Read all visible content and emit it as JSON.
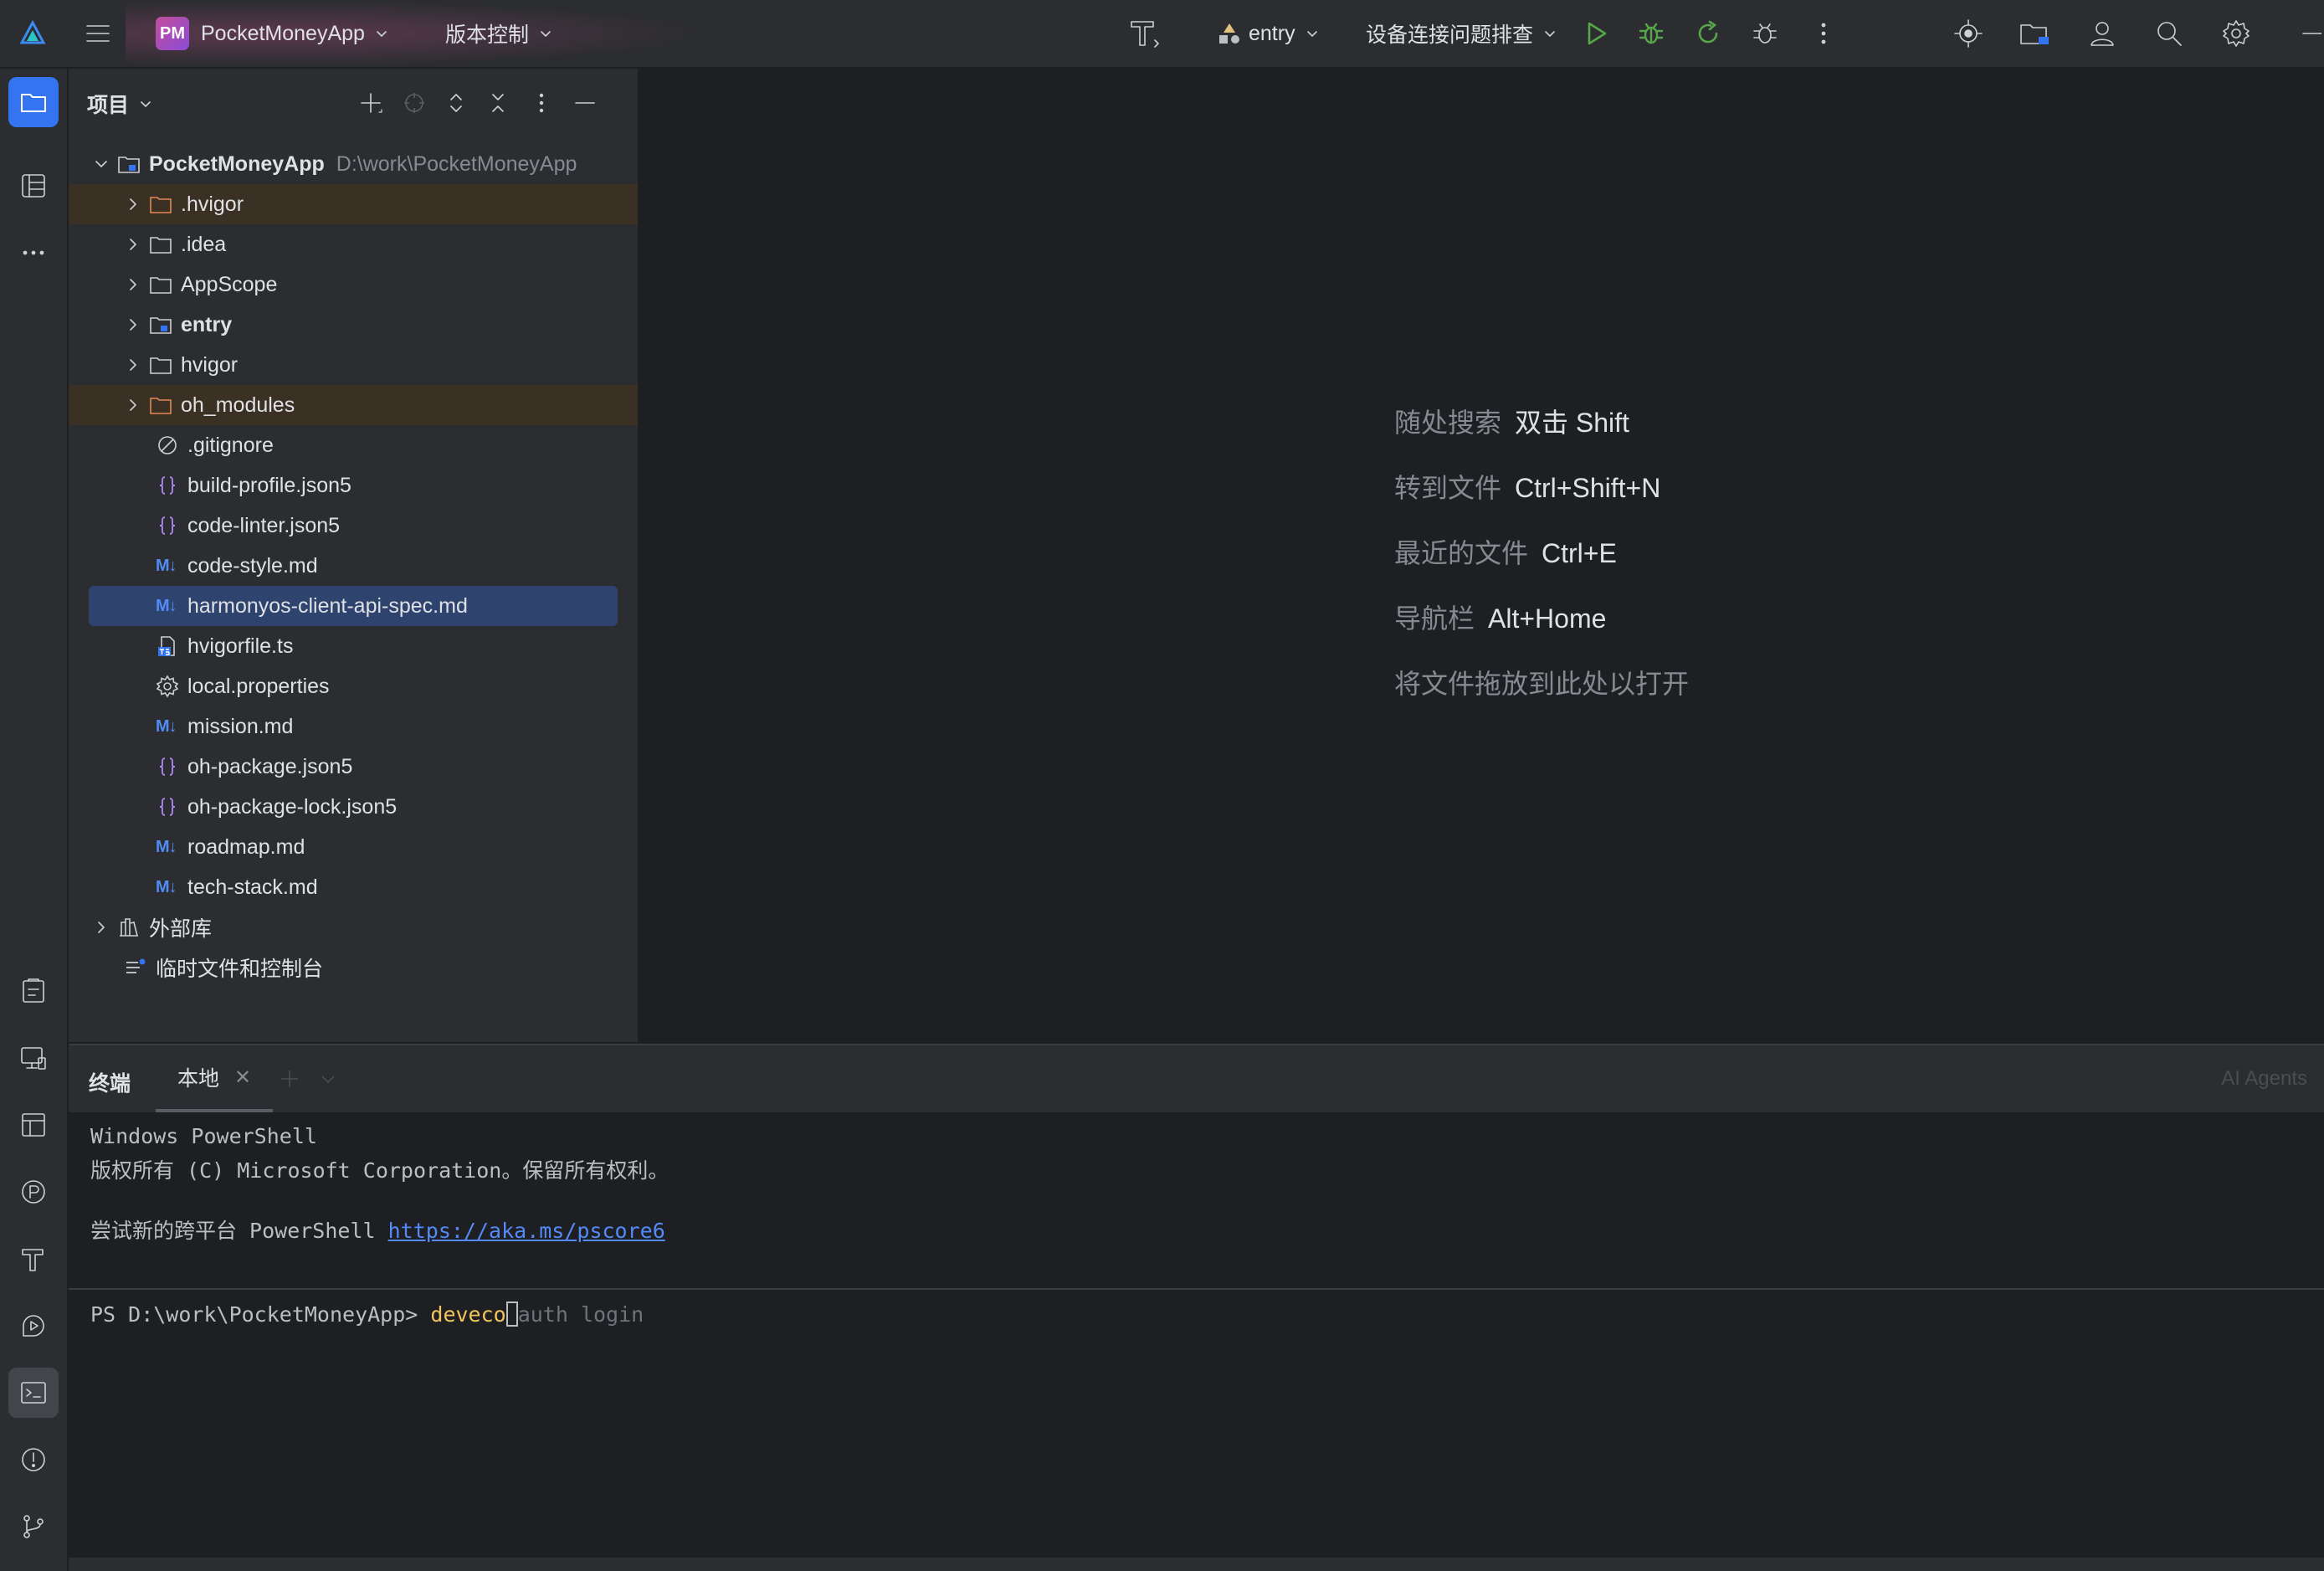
{
  "topbar": {
    "project_badge": "PM",
    "project_name": "PocketMoneyApp",
    "vcs_label": "版本控制",
    "module_label": "entry",
    "troubleshoot_label": "设备连接问题排查"
  },
  "project_panel": {
    "title": "项目",
    "root": {
      "name": "PocketMoneyApp",
      "path": "D:\\work\\PocketMoneyApp"
    },
    "items": [
      {
        "name": ".hvigor"
      },
      {
        "name": ".idea"
      },
      {
        "name": "AppScope"
      },
      {
        "name": "entry"
      },
      {
        "name": "hvigor"
      },
      {
        "name": "oh_modules"
      },
      {
        "name": ".gitignore"
      },
      {
        "name": "build-profile.json5"
      },
      {
        "name": "code-linter.json5"
      },
      {
        "name": "code-style.md"
      },
      {
        "name": "harmonyos-client-api-spec.md"
      },
      {
        "name": "hvigorfile.ts"
      },
      {
        "name": "local.properties"
      },
      {
        "name": "mission.md"
      },
      {
        "name": "oh-package.json5"
      },
      {
        "name": "oh-package-lock.json5"
      },
      {
        "name": "roadmap.md"
      },
      {
        "name": "tech-stack.md"
      }
    ],
    "external_libs": "外部库",
    "scratches": "临时文件和控制台",
    "md_badge": "M↓"
  },
  "editor": {
    "hints": [
      {
        "label": "随处搜索",
        "keys": "双击 Shift"
      },
      {
        "label": "转到文件",
        "keys": "Ctrl+Shift+N"
      },
      {
        "label": "最近的文件",
        "keys": "Ctrl+E"
      },
      {
        "label": "导航栏",
        "keys": "Alt+Home"
      }
    ],
    "drop_hint": "将文件拖放到此处以打开"
  },
  "terminal": {
    "title": "终端",
    "tab_label": "本地",
    "ai_agents": "AI Agents",
    "lines": [
      "Windows PowerShell",
      "版权所有 (C) Microsoft Corporation。保留所有权利。"
    ],
    "try_text": "尝试新的跨平台 PowerShell ",
    "link": "https://aka.ms/pscore6",
    "prompt": "PS D:\\work\\PocketMoneyApp> ",
    "typed": "deveco",
    "suggestion": "auth login"
  }
}
